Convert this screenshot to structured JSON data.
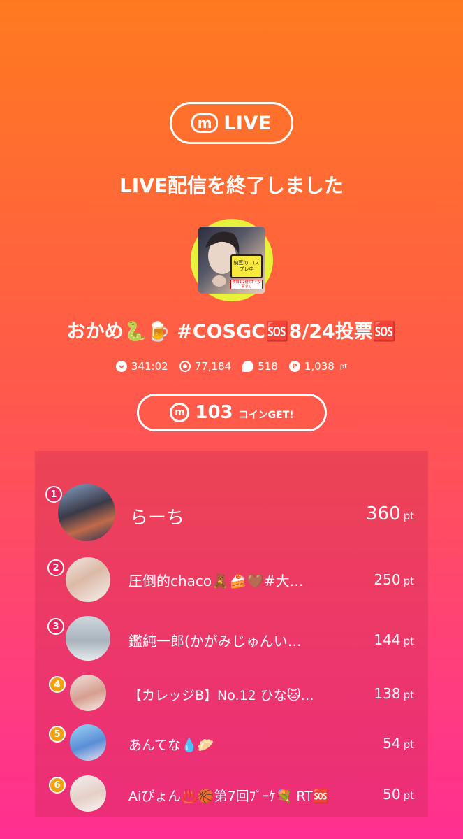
{
  "header": {
    "logo_letter": "m",
    "logo_text": "LIVE"
  },
  "title": "LIVE配信を終了しました",
  "streamer": {
    "name": "おかめ🐍🍺 #COSGC🆘8/24投票🆘",
    "avatar_caption_1": "納豆の コスプレ中",
    "avatar_caption_2": "初日1.2倍 RT・投票求む"
  },
  "stats": {
    "duration": "341:02",
    "viewers": "77,184",
    "comments": "518",
    "points": "1,038",
    "points_unit": "pt",
    "duration_icon": "clock-icon",
    "viewers_icon": "viewers-icon",
    "comments_icon": "comment-bubble-icon",
    "points_icon": "points-icon",
    "points_icon_letter": "P"
  },
  "coins": {
    "icon_letter": "m",
    "count": "103",
    "label": "コインGET!"
  },
  "ranking": [
    {
      "rank": "1",
      "name": "らーち",
      "pts": "360",
      "unit": "pt"
    },
    {
      "rank": "2",
      "name": "圧倒的chaco🧸🍰🤎#大…",
      "pts": "250",
      "unit": "pt"
    },
    {
      "rank": "3",
      "name": "鑑純一郎(かがみじゅんい…",
      "pts": "144",
      "unit": "pt"
    },
    {
      "rank": "4",
      "name": "【カレッジB】No.12 ひな🐱…",
      "pts": "138",
      "unit": "pt"
    },
    {
      "rank": "5",
      "name": "あんてな💧🥟",
      "pts": "54",
      "unit": "pt"
    },
    {
      "rank": "6",
      "name": "Aiぴょん♨️🏀第7回ﾌﾞｰｹ💐 RT🆘",
      "pts": "50",
      "unit": "pt"
    }
  ],
  "colors": {
    "rank1": "#e8265b",
    "rank2": "#e8265b",
    "rank3": "#e8265b",
    "rank4": "#f2a20c",
    "rank5": "#f2a20c",
    "rank6": "#f2a20c"
  }
}
